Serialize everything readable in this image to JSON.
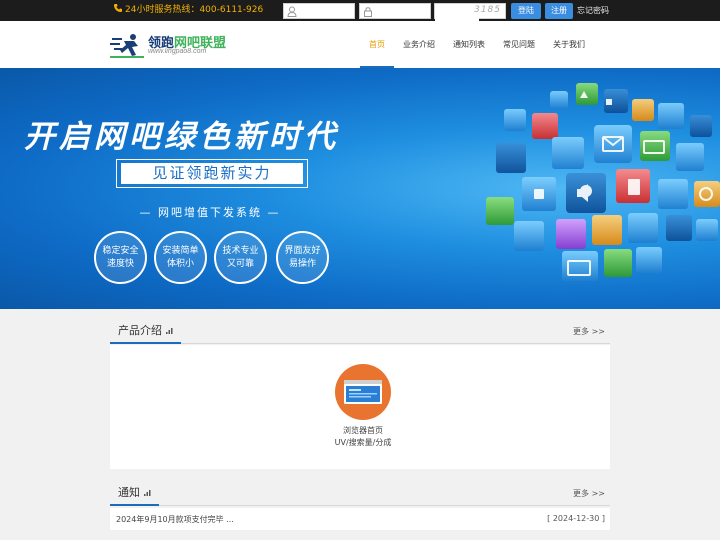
{
  "topbar": {
    "hotline": "24小时服务热线：400-6111-926",
    "username_placeholder": "",
    "password_placeholder": "",
    "captcha_value": "",
    "captcha_code": "3185",
    "login_label": "登陆",
    "register_label": "注册",
    "forgot_label": "忘记密码"
  },
  "logo": {
    "name_a": "领跑",
    "name_b": "网吧联盟",
    "url": "www.lingpao8.com"
  },
  "nav": {
    "items": [
      {
        "label": "首页",
        "active": true
      },
      {
        "label": "业务介绍"
      },
      {
        "label": "通知列表"
      },
      {
        "label": "常见问题"
      },
      {
        "label": "关于我们"
      }
    ]
  },
  "banner": {
    "title": "开启网吧绿色新时代",
    "subtitle": "见证领跑新实力",
    "tagline": "— 网吧增值下发系统 —",
    "features": [
      "稳定安全\n速度快",
      "安装简单\n体积小",
      "技术专业\n又可靠",
      "界面友好\n易操作"
    ]
  },
  "products": {
    "title": "产品介绍",
    "more": "更多 >>",
    "items": [
      {
        "name": "浏览器首页",
        "metric": "UV/搜索量/分成",
        "icon": "browser-window-icon"
      }
    ]
  },
  "notices": {
    "title": "通知",
    "more": "更多 >>",
    "items": [
      {
        "text": "2024年9月10月款项支付完毕 ...",
        "date": "[ 2024-12-30  ]"
      }
    ]
  },
  "colors": {
    "accent_blue": "#1a6db8",
    "nav_active": "#e89b00",
    "hotline": "#f2b100",
    "product_circle": "#e8742f",
    "button_blue": "#3b8de0"
  }
}
